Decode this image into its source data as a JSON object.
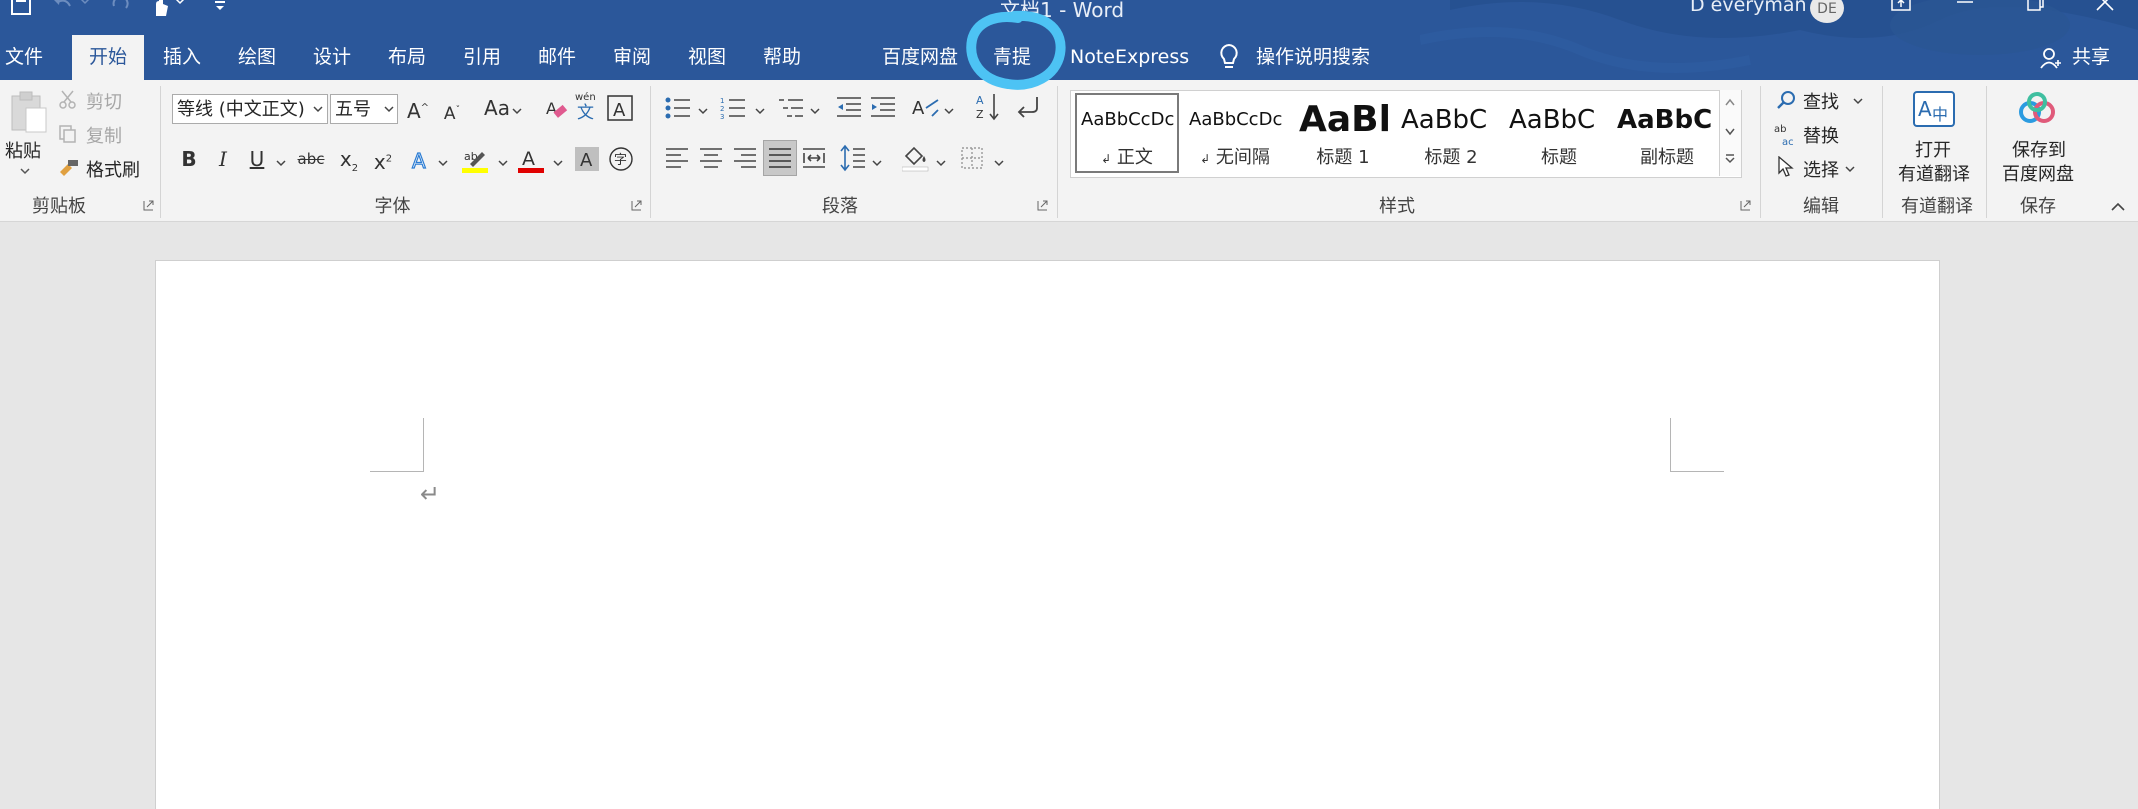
{
  "title_bar": {
    "document_title": "文档1 - Word",
    "user_name": "D everyman",
    "user_initials": "DE"
  },
  "tabs": [
    {
      "label": "文件"
    },
    {
      "label": "开始"
    },
    {
      "label": "插入"
    },
    {
      "label": "绘图"
    },
    {
      "label": "设计"
    },
    {
      "label": "布局"
    },
    {
      "label": "引用"
    },
    {
      "label": "邮件"
    },
    {
      "label": "审阅"
    },
    {
      "label": "视图"
    },
    {
      "label": "帮助"
    },
    {
      "label": "百度网盘"
    },
    {
      "label": "青提"
    },
    {
      "label": "NoteExpress"
    }
  ],
  "active_tab": "开始",
  "search_tab_label": "操作说明搜索",
  "share_label": "共享",
  "clipboard": {
    "paste": "粘贴",
    "cut": "剪切",
    "copy": "复制",
    "format_painter": "格式刷",
    "group_label": "剪贴板"
  },
  "font": {
    "font_name": "等线 (中文正文)",
    "font_size": "五号",
    "change_case": "Aa",
    "group_label": "字体"
  },
  "paragraph": {
    "group_label": "段落"
  },
  "styles": {
    "items": [
      {
        "preview": "AaBbCcDc",
        "name": "正文",
        "selected": true
      },
      {
        "preview": "AaBbCcDc",
        "name": "无间隔"
      },
      {
        "preview": "AaBl",
        "name": "标题 1"
      },
      {
        "preview": "AaBbC",
        "name": "标题 2"
      },
      {
        "preview": "AaBbC",
        "name": "标题"
      },
      {
        "preview": "AaBbC",
        "name": "副标题"
      }
    ],
    "group_label": "样式"
  },
  "editing": {
    "find": "查找",
    "replace": "替换",
    "select": "选择",
    "group_label": "编辑"
  },
  "youdao": {
    "button_line1": "打开",
    "button_line2": "有道翻译",
    "group_label": "有道翻译"
  },
  "save": {
    "button_line1": "保存到",
    "button_line2": "百度网盘",
    "group_label": "保存"
  },
  "colors": {
    "title_bar": "#2b579a",
    "ribbon": "#f3f3f3",
    "highlight": "#ffff00",
    "font_color": "#e00000",
    "annotation": "#4dc3f4"
  }
}
